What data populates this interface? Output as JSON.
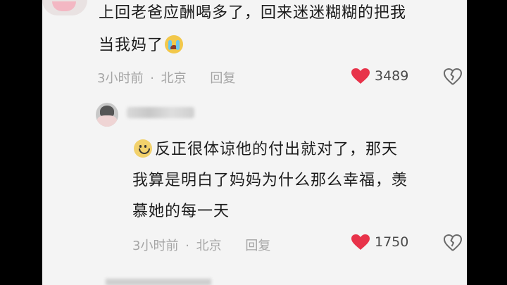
{
  "comment1": {
    "line1": "上回老爸应酬喝多了，回来迷迷糊糊的把我",
    "line2": "当我妈了",
    "time": "3小时前",
    "location": "北京",
    "reply_label": "回复",
    "likes": "3489"
  },
  "comment2": {
    "line1": "反正很体谅他的付出就对了，那天",
    "line2": "我算是明白了妈妈为什么那么幸福，羡",
    "line3": "慕她的每一天",
    "time": "3小时前",
    "location": "北京",
    "reply_label": "回复",
    "likes": "1750"
  },
  "colors": {
    "heart": "#e8334a",
    "panel_bg": "#f4f4f4",
    "text": "#1c1c1c",
    "meta": "#a5a5a5"
  },
  "icons": [
    "smiley-icon",
    "crying-face-icon",
    "heart-icon",
    "broken-heart-icon"
  ]
}
